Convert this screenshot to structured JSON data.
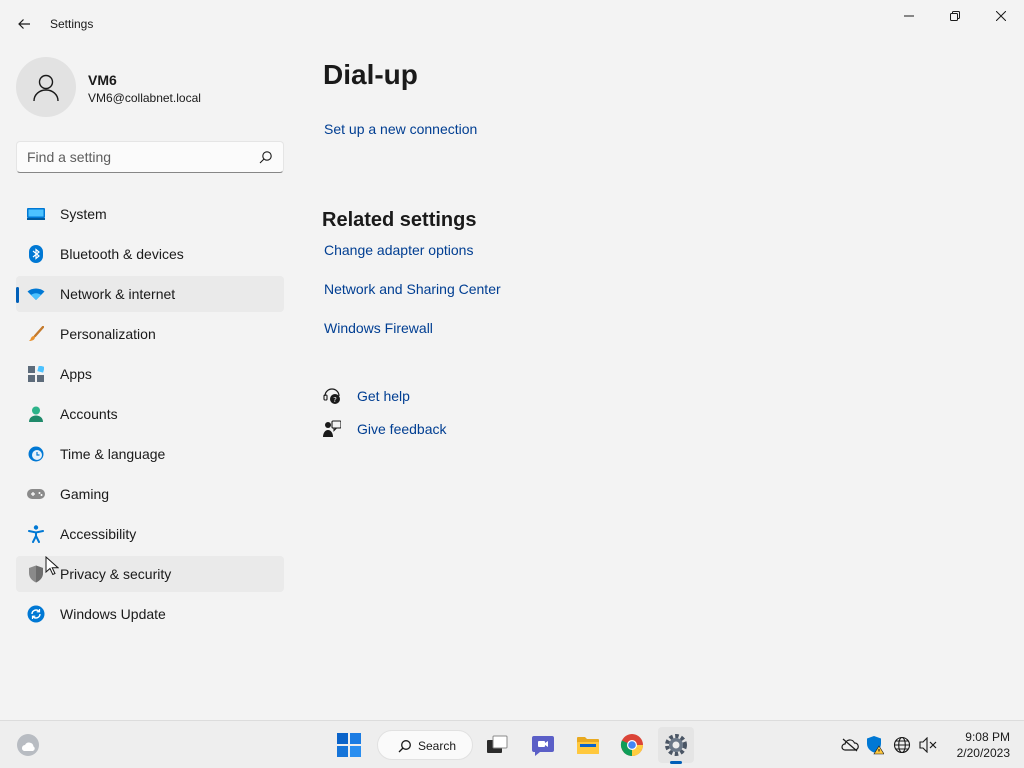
{
  "window": {
    "title": "Settings",
    "back_icon": "back-arrow-icon",
    "controls": [
      "minimize-icon",
      "restore-icon",
      "close-icon"
    ]
  },
  "profile": {
    "name": "VM6",
    "email": "VM6@collabnet.local",
    "avatar_icon": "person-icon"
  },
  "search": {
    "placeholder": "Find a setting",
    "icon": "search-icon"
  },
  "sidebar": {
    "selected": "Network & internet",
    "items": [
      {
        "label": "System",
        "icon": "system-icon",
        "color": "#0078d4"
      },
      {
        "label": "Bluetooth & devices",
        "icon": "bluetooth-icon",
        "color": "#0078d4"
      },
      {
        "label": "Network & internet",
        "icon": "wifi-icon",
        "color": "#0078d4"
      },
      {
        "label": "Personalization",
        "icon": "brush-icon",
        "color": "#e8912d"
      },
      {
        "label": "Apps",
        "icon": "apps-icon",
        "color": "#5d6b7a"
      },
      {
        "label": "Accounts",
        "icon": "accounts-icon",
        "color": "#2db38a"
      },
      {
        "label": "Time & language",
        "icon": "globe-clock-icon",
        "color": "#0078d4"
      },
      {
        "label": "Gaming",
        "icon": "gamepad-icon",
        "color": "#7a7a7a"
      },
      {
        "label": "Accessibility",
        "icon": "accessibility-icon",
        "color": "#0078d4"
      },
      {
        "label": "Privacy & security",
        "icon": "shield-icon",
        "color": "#8a8a8a"
      },
      {
        "label": "Windows Update",
        "icon": "update-icon",
        "color": "#0078d4"
      }
    ]
  },
  "main": {
    "title": "Dial-up",
    "setup_link": "Set up a new connection",
    "related_heading": "Related settings",
    "related_links": [
      "Change adapter options",
      "Network and Sharing Center",
      "Windows Firewall"
    ],
    "get_help": "Get help",
    "give_feedback": "Give feedback"
  },
  "taskbar": {
    "search_label": "Search",
    "apps": [
      "start-icon",
      "search-icon",
      "task-view-icon",
      "chat-icon",
      "file-explorer-icon",
      "chrome-icon",
      "settings-icon"
    ],
    "active_app": "settings-icon",
    "tray": [
      "onedrive-icon",
      "defender-warning-icon",
      "network-icon",
      "volume-muted-icon"
    ],
    "time": "9:08 PM",
    "date": "2/20/2023"
  },
  "colors": {
    "accent": "#005fb8",
    "link": "#003e92",
    "background": "#f3f3f3"
  }
}
